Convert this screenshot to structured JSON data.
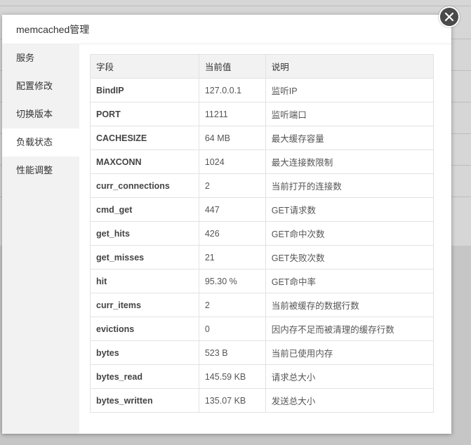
{
  "dialog": {
    "title": "memcached管理"
  },
  "sidebar": {
    "items": [
      {
        "label": "服务"
      },
      {
        "label": "配置修改"
      },
      {
        "label": "切换版本"
      },
      {
        "label": "负载状态",
        "active": true
      },
      {
        "label": "性能调整"
      }
    ]
  },
  "table": {
    "headers": [
      "字段",
      "当前值",
      "说明"
    ],
    "rows": [
      [
        "BindIP",
        "127.0.0.1",
        "监听IP"
      ],
      [
        "PORT",
        "11211",
        "监听端口"
      ],
      [
        "CACHESIZE",
        "64 MB",
        "最大缓存容量"
      ],
      [
        "MAXCONN",
        "1024",
        "最大连接数限制"
      ],
      [
        "curr_connections",
        "2",
        "当前打开的连接数"
      ],
      [
        "cmd_get",
        "447",
        "GET请求数"
      ],
      [
        "get_hits",
        "426",
        "GET命中次数"
      ],
      [
        "get_misses",
        "21",
        "GET失败次数"
      ],
      [
        "hit",
        "95.30 %",
        "GET命中率"
      ],
      [
        "curr_items",
        "2",
        "当前被缓存的数据行数"
      ],
      [
        "evictions",
        "0",
        "因内存不足而被清理的缓存行数"
      ],
      [
        "bytes",
        "523 B",
        "当前已使用内存"
      ],
      [
        "bytes_read",
        "145.59 KB",
        "请求总大小"
      ],
      [
        "bytes_written",
        "135.07 KB",
        "发送总大小"
      ]
    ]
  },
  "icons": {
    "close": "close-icon"
  }
}
